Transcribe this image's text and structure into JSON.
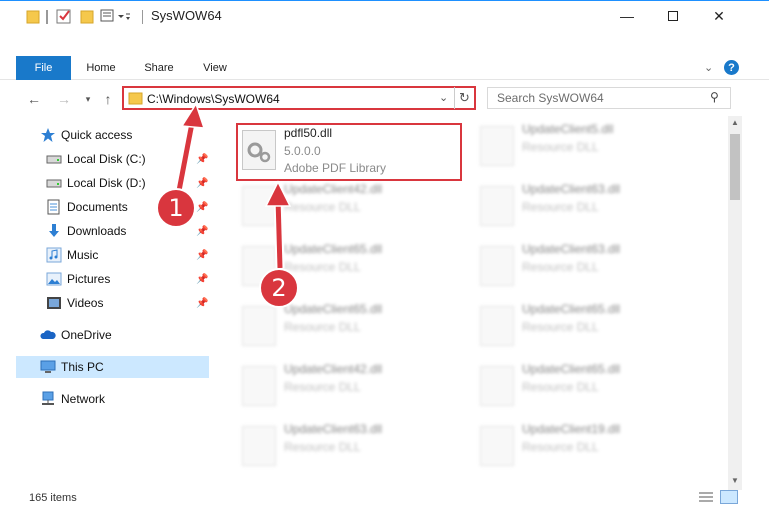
{
  "window": {
    "title": "SysWOW64",
    "minimize_icon": "minimize-icon",
    "maximize_icon": "maximize-icon",
    "close_icon": "close-icon"
  },
  "ribbon": {
    "tabs": [
      {
        "label": "File"
      },
      {
        "label": "Home"
      },
      {
        "label": "Share"
      },
      {
        "label": "View"
      }
    ]
  },
  "navigation": {
    "address_path": "C:\\Windows\\SysWOW64",
    "search_placeholder": "Search SysWOW64"
  },
  "sidebar": {
    "items": [
      {
        "label": "Quick access",
        "icon": "star-icon"
      },
      {
        "label": "Local Disk (C:)",
        "icon": "drive-icon",
        "pinned": true
      },
      {
        "label": "Local Disk (D:)",
        "icon": "drive-icon",
        "pinned": true
      },
      {
        "label": "Documents",
        "icon": "documents-icon",
        "pinned": true
      },
      {
        "label": "Downloads",
        "icon": "download-icon",
        "pinned": true
      },
      {
        "label": "Music",
        "icon": "music-icon",
        "pinned": true
      },
      {
        "label": "Pictures",
        "icon": "pictures-icon",
        "pinned": true
      },
      {
        "label": "Videos",
        "icon": "videos-icon",
        "pinned": true
      },
      {
        "label": "OneDrive",
        "icon": "cloud-icon"
      },
      {
        "label": "This PC",
        "icon": "computer-icon",
        "selected": true
      },
      {
        "label": "Network",
        "icon": "network-icon"
      }
    ]
  },
  "files": {
    "highlighted": {
      "name": "pdfl50.dll",
      "version": "5.0.0.0",
      "description": "Adobe PDF Library"
    },
    "col1": [
      {
        "name": "UpdateClient42.dll",
        "description": "Resource DLL"
      },
      {
        "name": "UpdateClient65.dll",
        "description": "Resource DLL"
      },
      {
        "name": "UpdateClient65.dll",
        "description": "Resource DLL"
      },
      {
        "name": "UpdateClient42.dll",
        "description": "Resource DLL"
      },
      {
        "name": "UpdateClient63.dll",
        "description": "Resource DLL"
      }
    ],
    "col2": [
      {
        "name": "UpdateClient5.dll",
        "description": "Resource DLL"
      },
      {
        "name": "UpdateClient63.dll",
        "description": "Resource DLL"
      },
      {
        "name": "UpdateClient63.dll",
        "description": "Resource DLL"
      },
      {
        "name": "UpdateClient65.dll",
        "description": "Resource DLL"
      },
      {
        "name": "UpdateClient65.dll",
        "description": "Resource DLL"
      },
      {
        "name": "UpdateClient19.dll",
        "description": "Resource DLL"
      }
    ]
  },
  "status": {
    "item_count": "165 items"
  },
  "annotations": {
    "step1": "1",
    "step2": "2",
    "color": "#d9363e"
  }
}
